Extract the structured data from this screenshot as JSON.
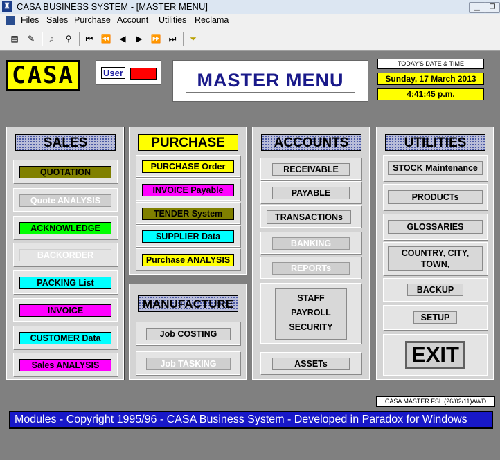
{
  "window": {
    "title": "CASA BUSINESS SYSTEM - [MASTER MENU]",
    "minimize": "▁",
    "restore": "❐"
  },
  "menubar": [
    "Files",
    "Sales",
    "Purchase",
    "Account",
    "Utilities",
    "Reclama"
  ],
  "logo": "CASA",
  "user": {
    "label": "User",
    "status_color": "#ff0000"
  },
  "header": {
    "title": "MASTER  MENU"
  },
  "datetime": {
    "label": "TODAY'S DATE & TIME",
    "date": "Sunday, 17 March 2013",
    "time": "4:41:45 p.m."
  },
  "sales": {
    "title": "SALES",
    "items": [
      "QUOTATION",
      "Quote ANALYSIS",
      "ACKNOWLEDGE",
      "BACKORDER",
      "PACKING List",
      "INVOICE",
      "CUSTOMER Data",
      "Sales ANALYSIS"
    ]
  },
  "purchase": {
    "title": "PURCHASE",
    "items": [
      "PURCHASE Order",
      "INVOICE Payable",
      "TENDER System",
      "SUPPLIER Data",
      "Purchase ANALYSIS"
    ]
  },
  "manufacture": {
    "title": "MANUFACTURE",
    "items": [
      "Job COSTING",
      "Job TASKING"
    ]
  },
  "accounts": {
    "title": "ACCOUNTS",
    "items": [
      "RECEIVABLE",
      "PAYABLE",
      "TRANSACTIONs",
      "BANKING",
      "REPORTs"
    ],
    "staff_lines": [
      "STAFF",
      "PAYROLL",
      "SECURITY"
    ],
    "assets": "ASSETs"
  },
  "utilities": {
    "title": "UTILITIES",
    "items": [
      "STOCK Maintenance",
      "PRODUCTs",
      "GLOSSARIES",
      "BACKUP",
      "SETUP"
    ],
    "country_lines": [
      "COUNTRY, CITY,",
      "TOWN,"
    ],
    "exit": "EXIT"
  },
  "footer": {
    "file_label": "CASA MASTER.FSL (26/02/11)AWD",
    "ticker": "Modules - Copyright 1995/96 - CASA Business System - Developed in Paradox for Windows"
  },
  "colors": {
    "olive": "#808000",
    "yellow": "#ffff00",
    "magenta": "#ff00ff",
    "cyan": "#00ffff",
    "green": "#00ff00",
    "ticker_bg": "#1818c8"
  }
}
